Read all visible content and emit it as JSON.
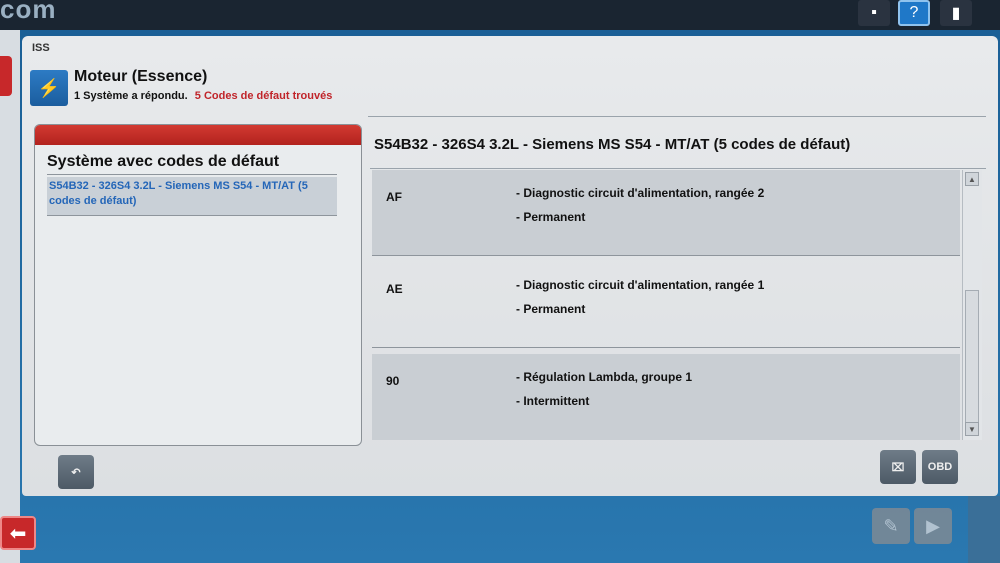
{
  "app": {
    "brand": "com",
    "tab_label": "ISS"
  },
  "header": {
    "title": "Moteur (Essence)",
    "status": "1 Système a répondu.",
    "codes_found": "5 Codes de défaut trouvés"
  },
  "left_panel": {
    "title": "Système avec codes de défaut",
    "items": [
      {
        "label": "S54B32 - 326S4 3.2L - Siemens MS S54 - MT/AT (5 codes de défaut)"
      }
    ]
  },
  "detail": {
    "title": "S54B32 - 326S4 3.2L - Siemens MS S54 - MT/AT (5 codes de défaut)",
    "codes": [
      {
        "id": "AF",
        "description": "- Diagnostic circuit d'alimentation, rangée 2",
        "type": "- Permanent"
      },
      {
        "id": "AE",
        "description": "- Diagnostic circuit d'alimentation, rangée 1",
        "type": "- Permanent"
      },
      {
        "id": "90",
        "description": "- Régulation Lambda, groupe 1",
        "type": "- Intermittent"
      }
    ]
  },
  "buttons": {
    "obd": "OBD"
  },
  "icons": {
    "module": "engine-fuel-icon",
    "return": "return-arrow-icon",
    "clear_codes": "erase-codes-icon",
    "back": "back-arrow-icon",
    "next": "next-arrow-icon"
  },
  "colors": {
    "accent_red": "#c0242a",
    "link_blue": "#2466b8",
    "frame_blue": "#1a5f96"
  }
}
